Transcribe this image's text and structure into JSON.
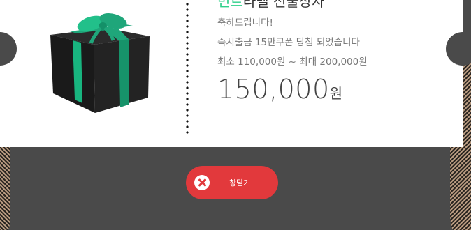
{
  "popup": {
    "title_accent": "민트",
    "title_rest": "라벨 선물상자",
    "congrats": "축하드립니다!",
    "message": "즉시출금 15만쿠폰 당첨 되었습니다",
    "range": "최소 110,000원 ~ 최대 200,000원",
    "prize_amount": "150,000",
    "prize_unit": "원"
  },
  "close_button": {
    "label": "창닫기"
  },
  "colors": {
    "accent": "#2fd08a",
    "close_button": "#e2393c",
    "ribbon": "#1fa67a",
    "backdrop": "#4a4a4a"
  }
}
